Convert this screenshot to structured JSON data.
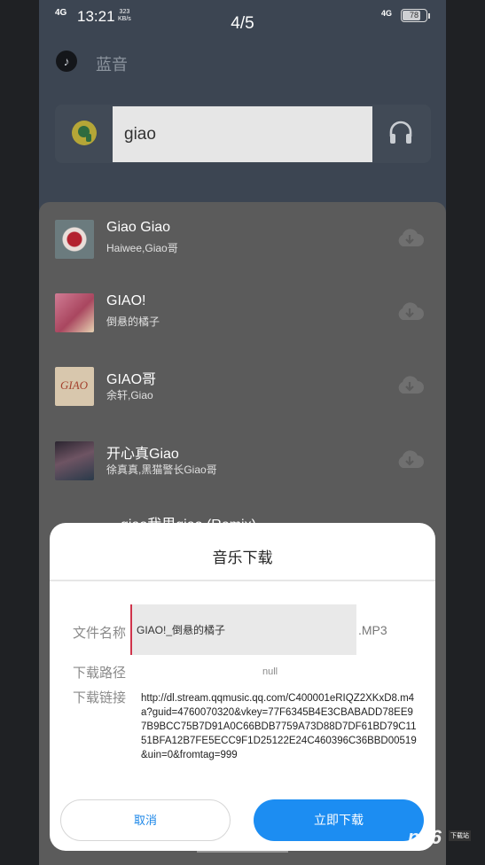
{
  "status_bar": {
    "network": "4G",
    "time": "13:21",
    "speed_value": "323",
    "speed_unit": "KB/s",
    "page_indicator": "4/5",
    "network2": "4G",
    "battery": "78"
  },
  "header": {
    "title": "蓝音",
    "icon": "music-note-icon"
  },
  "search": {
    "value": "giao",
    "source_icon": "qq-music-icon",
    "action_icon": "headphones-icon"
  },
  "songs": [
    {
      "title": "Giao Giao",
      "artist": "Haiwee,Giao哥",
      "cover_color": "#8f5f66"
    },
    {
      "title": "GIAO!",
      "artist": "倒悬的橘子",
      "cover_color": "#b46c82"
    },
    {
      "title": "GIAO哥",
      "artist": "余轩,Giao",
      "cover_color": "#c9b59c"
    },
    {
      "title": "开心真Giao",
      "artist": "徐真真,黑猫警长Giao哥",
      "cover_color": "#4a4250"
    },
    {
      "title": "一giao我里giao (Remix)",
      "artist": "",
      "cover_color": "#555555"
    }
  ],
  "dialog": {
    "title": "音乐下载",
    "file_name_label": "文件名称",
    "file_name_value": "GIAO!_倒悬的橘子",
    "extension": ".MP3",
    "path_label": "下载路径",
    "path_value": "null",
    "link_label": "下载链接",
    "link_value": "http://dl.stream.qqmusic.qq.com/C400001eRIQZ2XKxD8.m4a?guid=4760070320&vkey=77F6345B4E3CBABADD78EE97B9BCC75B7D91A0C66BDB7759A73D88D7DF61BD79C1151BFA12B7FE5ECC9F1D25122E24C460396C36BBD00519&uin=0&fromtag=999",
    "cancel_label": "取消",
    "confirm_label": "立即下载"
  },
  "background_button": "下载",
  "watermark": {
    "logo": "pc6",
    "tag": "下载站"
  },
  "colors": {
    "accent": "#1c8df2",
    "background": "#3c4552",
    "sheet": "#5b5b5b"
  }
}
